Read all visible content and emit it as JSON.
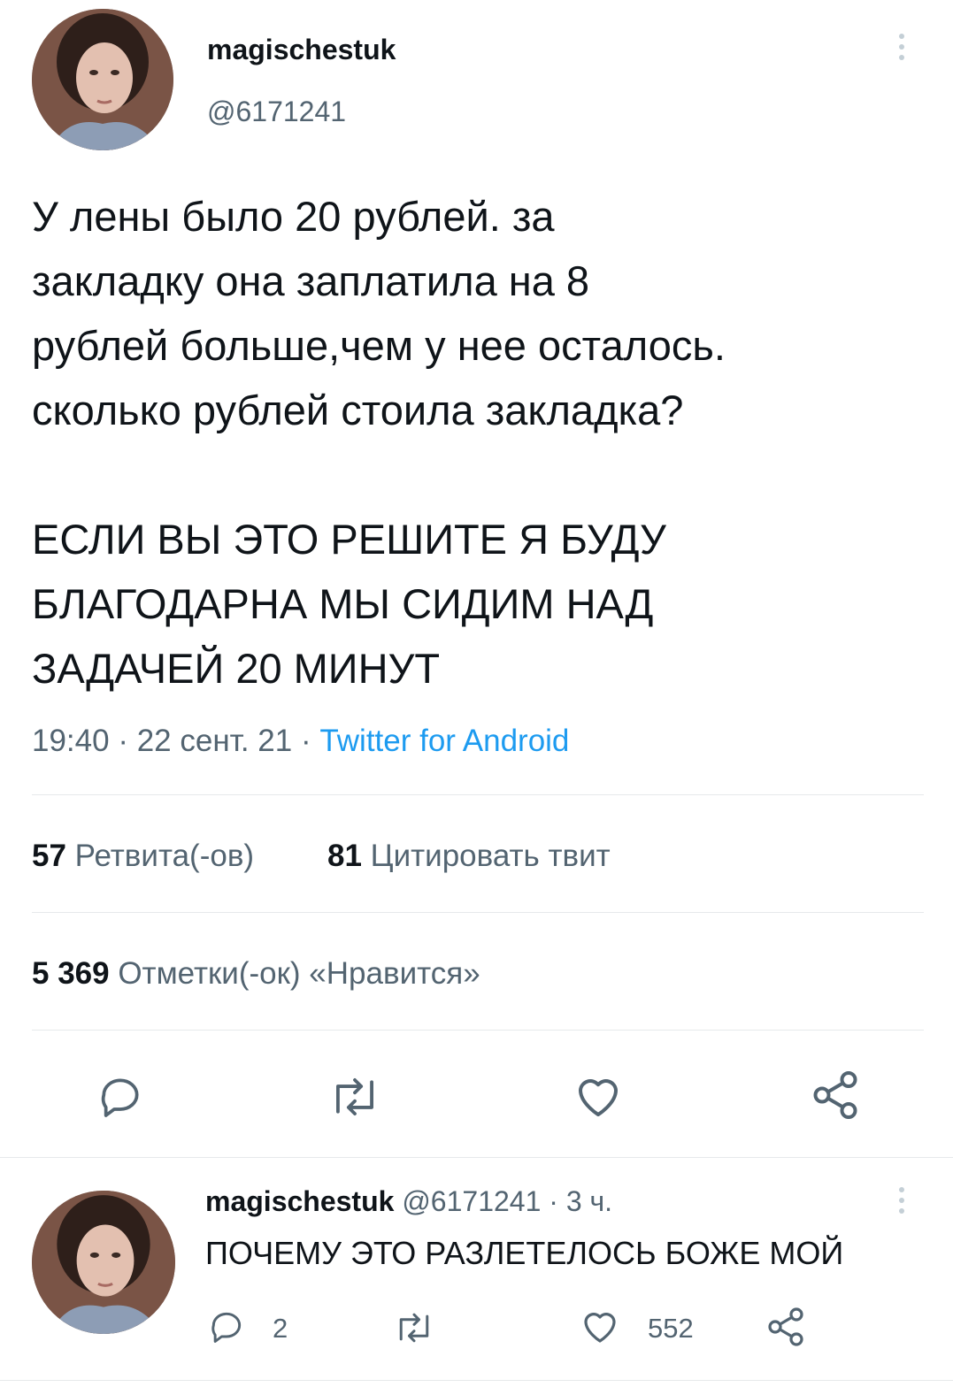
{
  "tweet": {
    "author_name": "magischestuk",
    "author_handle": "@6171241",
    "text": "У лены было 20 рублей. за\nзакладку она заплатила на 8\nрублей больше,чем у нее осталось.\nсколько рублей стоила закладка?\n\nЕСЛИ ВЫ ЭТО РЕШИТЕ Я БУДУ\nБЛАГОДАРНА МЫ СИДИМ НАД\nЗАДАЧЕЙ 20 МИНУТ",
    "time": "19:40",
    "date": "22 сент. 21",
    "source": "Twitter for Android",
    "retweets_count": "57",
    "retweets_label": "Ретвита(-ов)",
    "quotes_count": "81",
    "quotes_label": "Цитировать твит",
    "likes_count": "5 369",
    "likes_label": "Отметки(-ок) «Нравится»",
    "actions": [
      "reply-icon",
      "retweet-icon",
      "like-icon",
      "share-icon"
    ]
  },
  "reply": {
    "author_name": "magischestuk",
    "author_handle": "@6171241",
    "age": "3 ч.",
    "text": "ПОЧЕМУ ЭТО РАЗЛЕТЕЛОСЬ БОЖЕ МОЙ",
    "reply_count": "2",
    "like_count": "552"
  },
  "colors": {
    "text": "#0f1419",
    "secondary": "#536471",
    "link": "#1d9bf0",
    "divider": "#e6e9eb"
  },
  "separator": "·"
}
